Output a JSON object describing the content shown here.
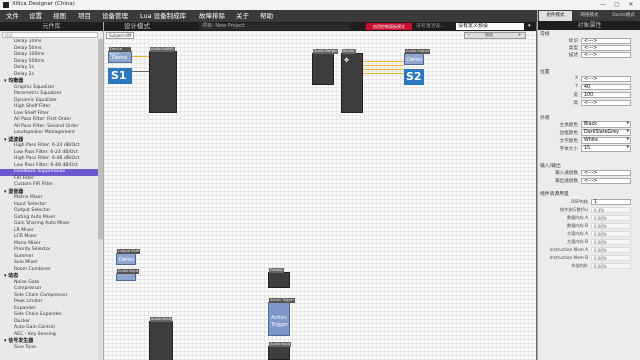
{
  "window": {
    "title": "Xilica Designer (China)",
    "controls": [
      "—",
      "▢",
      "✕"
    ]
  },
  "menu": [
    "文件",
    "设置",
    "视图",
    "项目",
    "设备管理",
    "Lua 设备制成库",
    "故障排除",
    "关于",
    "帮助"
  ],
  "library": {
    "header": "元件库",
    "search_placeholder": "搜索",
    "rows": [
      {
        "t": "item",
        "label": "Delay 10ms"
      },
      {
        "t": "item",
        "label": "Delay 50ms"
      },
      {
        "t": "item",
        "label": "Delay 100ms"
      },
      {
        "t": "item",
        "label": "Delay 500ms"
      },
      {
        "t": "item",
        "label": "Delay 1s"
      },
      {
        "t": "item",
        "label": "Delay 2s"
      },
      {
        "t": "cat",
        "label": "均衡器"
      },
      {
        "t": "item",
        "label": "Graphic Equalizer"
      },
      {
        "t": "item",
        "label": "Parametric Equalizer"
      },
      {
        "t": "item",
        "label": "Dynamic Equalizer"
      },
      {
        "t": "item",
        "label": "High Shelf Filter"
      },
      {
        "t": "item",
        "label": "Low Shelf Filter"
      },
      {
        "t": "item",
        "label": "All Pass Filter: First Order"
      },
      {
        "t": "item",
        "label": "All Pass Filter: Second Order"
      },
      {
        "t": "item",
        "label": "Loudspeaker Management"
      },
      {
        "t": "cat",
        "label": "滤波器"
      },
      {
        "t": "item",
        "label": "High Pass Filter: 6-24 dB/Oct"
      },
      {
        "t": "item",
        "label": "Low Pass Filter: 6-24 dB/Oct"
      },
      {
        "t": "item",
        "label": "High Pass Filter: 6-48 dB/Oct"
      },
      {
        "t": "item",
        "label": "Low Pass Filter: 6-48 dB/Oct"
      },
      {
        "t": "item",
        "label": "Feedback Suppression",
        "sel": true
      },
      {
        "t": "item",
        "label": "FIR Filter"
      },
      {
        "t": "item",
        "label": "Custom FIR Filter"
      },
      {
        "t": "cat",
        "label": "混音器"
      },
      {
        "t": "item",
        "label": "Matrix Mixer"
      },
      {
        "t": "item",
        "label": "Input Selector"
      },
      {
        "t": "item",
        "label": "Output Selector"
      },
      {
        "t": "item",
        "label": "Gating Auto Mixer"
      },
      {
        "t": "item",
        "label": "Gain Sharing Auto Mixer"
      },
      {
        "t": "item",
        "label": "LR Mixer"
      },
      {
        "t": "item",
        "label": "LCR Mixer"
      },
      {
        "t": "item",
        "label": "Mono Mixer"
      },
      {
        "t": "item",
        "label": "Priority Selector"
      },
      {
        "t": "item",
        "label": "Summer"
      },
      {
        "t": "item",
        "label": "Solo Mixer"
      },
      {
        "t": "item",
        "label": "Room Combiner"
      },
      {
        "t": "cat",
        "label": "动态"
      },
      {
        "t": "item",
        "label": "Noise Gate"
      },
      {
        "t": "item",
        "label": "Compressor"
      },
      {
        "t": "item",
        "label": "Side Chain Compressor"
      },
      {
        "t": "item",
        "label": "Peak Limiter"
      },
      {
        "t": "item",
        "label": "Expander"
      },
      {
        "t": "item",
        "label": "Side Chain Expander"
      },
      {
        "t": "item",
        "label": "Ducker"
      },
      {
        "t": "item",
        "label": "Auto Gain Control"
      },
      {
        "t": "item",
        "label": "AEC - Key Sensing"
      },
      {
        "t": "cat",
        "label": "信号发生器"
      },
      {
        "t": "item",
        "label": "Sine Tone"
      }
    ]
  },
  "toolbar": {
    "mode": "设计模式",
    "project": "项目: New Project",
    "red_button": "启用控制面板模式",
    "device_info": "没有激活设...",
    "preset": "没有定义预设",
    "canvas_tab": "Subject-0M",
    "zoom_label": "缩放",
    "zoom_minus": "−",
    "zoom_plus": "+"
  },
  "canvas": {
    "blocks": [
      {
        "cap": "Device Input"
      },
      {
        "cap": "Audio Switch"
      },
      {
        "cap": "Audio Merger"
      },
      {
        "cap": "Router"
      },
      {
        "cap": "Audio Output"
      },
      {
        "cap": "Output Shift"
      },
      {
        "cap": "Audio Input"
      },
      {
        "cap": "Audio Input"
      },
      {
        "cap": "Presets"
      },
      {
        "cap": "Action Trigger"
      },
      {
        "cap": "Audio Input"
      }
    ],
    "labels": {
      "demo1": "Demo",
      "demo2": "Demo",
      "demo3": "Demo",
      "s1": "S1",
      "s2": "S2",
      "action": "Action",
      "trigger": "Trigger"
    }
  },
  "right": {
    "tabs": [
      "组件模式",
      "网络模式",
      "Dante模式"
    ],
    "header": "对象属性",
    "general_label": "常规",
    "name_label": "标识",
    "name_val": "<--->",
    "type_label": "类型",
    "type_val": "<--->",
    "desc_label": "描述",
    "desc_val": "<--->",
    "position_label": "位置",
    "x_label": "X",
    "x_val": "<--->",
    "y_label": "Y",
    "y_val": "40",
    "w_label": "宽",
    "w_val": "100",
    "h_label": "高",
    "h_val": "<--->",
    "appearance_label": "外观",
    "fill_label": "主体颜色",
    "fill_val": "Black",
    "border_label": "边框颜色",
    "border_val": "DarkSlateGrey",
    "text_label": "文字颜色",
    "text_val": "White",
    "font_label": "字体大小",
    "font_val": "15",
    "io_label": "输入/输出",
    "in_label": "输入通道数",
    "in_val": "<--->",
    "out_label": "输出通道数",
    "out_val": "<--->",
    "res_label": "组件资源用量",
    "res_rows": [
      {
        "label": "DSP内核",
        "val": "1"
      },
      {
        "label": "指令执行数(%)",
        "val": "0.4%"
      },
      {
        "label": "数据内存 A",
        "val": "0.00%"
      },
      {
        "label": "数据内存 B",
        "val": "0.00%"
      },
      {
        "label": "方案内存 A",
        "val": "0.00%"
      },
      {
        "label": "方案内存 B",
        "val": "0.00%"
      },
      {
        "label": "Instruction Mem A",
        "val": "0.00%"
      },
      {
        "label": "Instruction Mem B",
        "val": "0.00%"
      },
      {
        "label": "外部内存",
        "val": "0.00%"
      }
    ]
  }
}
